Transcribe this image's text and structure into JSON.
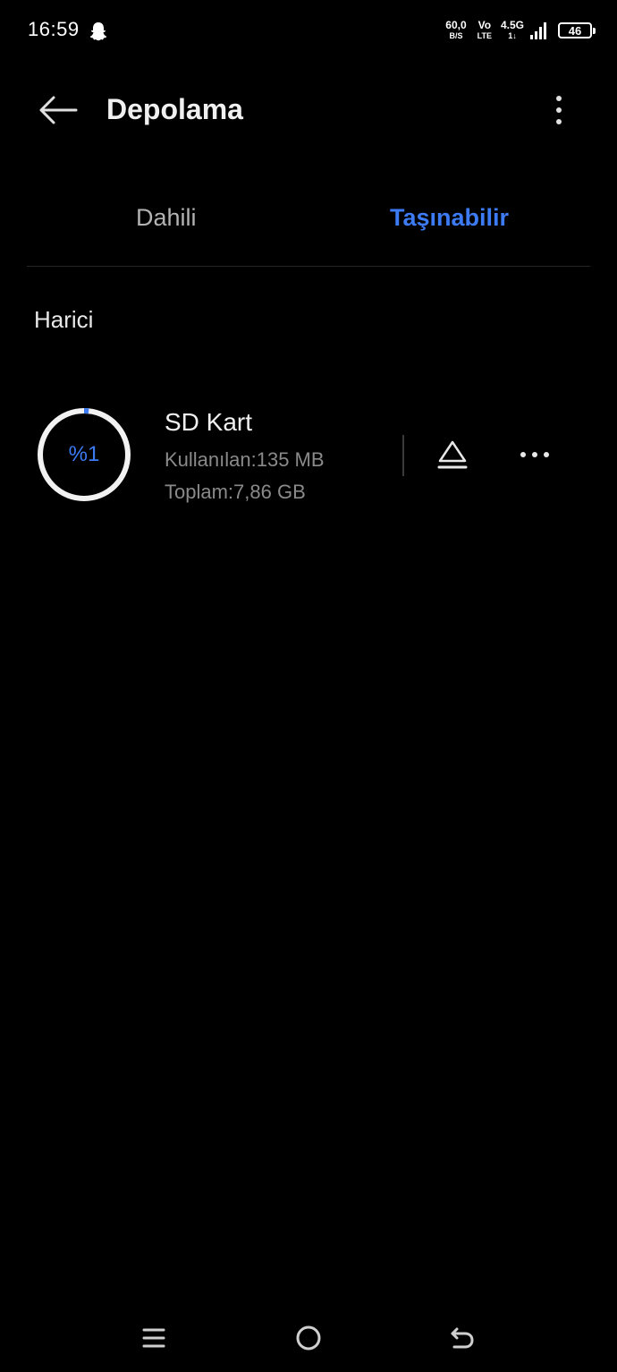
{
  "status_bar": {
    "time": "16:59",
    "net_speed_value": "60,0",
    "net_speed_unit": "B/S",
    "volte_top": "Vo",
    "volte_bottom": "LTE",
    "network_type": "4.5G",
    "network_arrows": "1↓",
    "battery_level": "46",
    "icons": [
      "snapchat-icon",
      "signal-icon",
      "battery-icon"
    ]
  },
  "header": {
    "title": "Depolama",
    "back_icon": "arrow-left-icon",
    "menu_icon": "more-vertical-icon"
  },
  "tabs": [
    {
      "label": "Dahili",
      "active": false
    },
    {
      "label": "Taşınabilir",
      "active": true
    }
  ],
  "section": {
    "title": "Harici"
  },
  "sd_card": {
    "name": "SD Kart",
    "used_text": "Kullanılan:135 MB",
    "total_text": "Toplam:7,86 GB",
    "percent_label": "%1",
    "used_fraction": 0.017,
    "eject_icon": "eject-icon",
    "more_icon": "more-horizontal-icon"
  },
  "nav_bar": {
    "icons": [
      "menu-icon",
      "home-icon",
      "back-icon"
    ]
  },
  "colors": {
    "background": "#000000",
    "accent": "#3d7bf5",
    "primary_text": "#f0f0f0",
    "secondary_text": "#8a8a8a",
    "inactive_tab": "#b3b3b3"
  }
}
